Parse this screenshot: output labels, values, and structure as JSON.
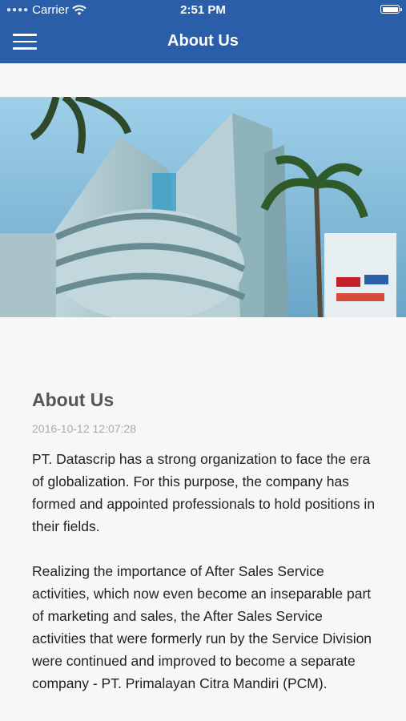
{
  "status_bar": {
    "carrier": "Carrier",
    "time": "2:51 PM"
  },
  "nav": {
    "title": "About Us",
    "menu_icon": "hamburger-menu-icon"
  },
  "article": {
    "heading": "About Us",
    "date": "2016-10-12 12:07:28",
    "paragraphs": [
      "PT. Datascrip has a strong organization to face the era of globalization. For this purpose, the company has formed and appointed professionals to hold positions in their fields.",
      "Realizing the importance of After Sales Service activities, which now even become an inseparable part of marketing and sales, the After Sales Service activities that were formerly run by the Service Division were continued and improved to become a separate company - PT. Primalayan Citra Mandiri (PCM)."
    ]
  },
  "colors": {
    "nav_bg": "#2a5ea8",
    "page_bg": "#f7f7f7"
  }
}
